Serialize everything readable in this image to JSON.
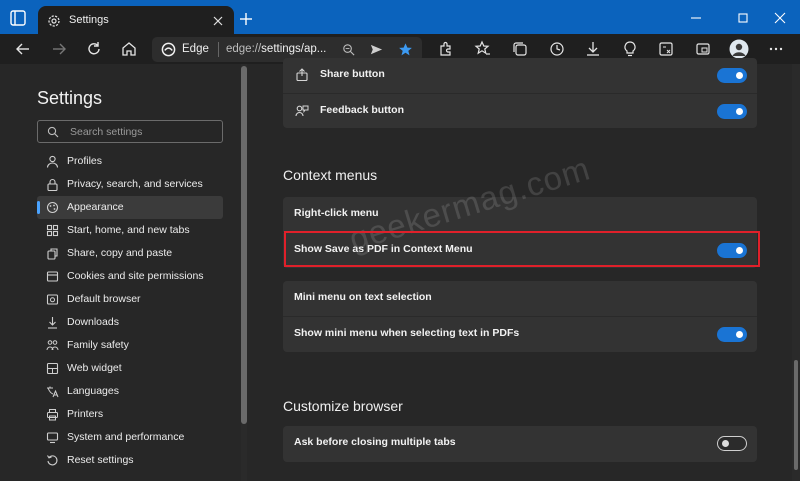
{
  "browser": {
    "tab_title": "Settings",
    "address": {
      "site_label": "Edge",
      "url_scheme": "edge://",
      "url_rest": "settings/ap..."
    }
  },
  "sidebar": {
    "title": "Settings",
    "search_placeholder": "Search settings",
    "items": [
      {
        "label": "Profiles",
        "icon": "profile-icon"
      },
      {
        "label": "Privacy, search, and services",
        "icon": "lock-icon"
      },
      {
        "label": "Appearance",
        "icon": "appearance-icon",
        "active": true
      },
      {
        "label": "Start, home, and new tabs",
        "icon": "home-grid-icon"
      },
      {
        "label": "Share, copy and paste",
        "icon": "share-icon"
      },
      {
        "label": "Cookies and site permissions",
        "icon": "cookie-icon"
      },
      {
        "label": "Default browser",
        "icon": "browser-icon"
      },
      {
        "label": "Downloads",
        "icon": "download-icon"
      },
      {
        "label": "Family safety",
        "icon": "family-icon"
      },
      {
        "label": "Web widget",
        "icon": "widget-icon"
      },
      {
        "label": "Languages",
        "icon": "language-icon"
      },
      {
        "label": "Printers",
        "icon": "printer-icon"
      },
      {
        "label": "System and performance",
        "icon": "system-icon"
      },
      {
        "label": "Reset settings",
        "icon": "reset-icon"
      }
    ]
  },
  "main": {
    "toolbar_buttons_card": {
      "rows": [
        {
          "label": "Share button",
          "icon": "share-icon",
          "toggle": "on"
        },
        {
          "label": "Feedback button",
          "icon": "feedback-icon",
          "toggle": "on"
        }
      ]
    },
    "context_menus": {
      "title": "Context menus",
      "right_click_card": {
        "header": "Right-click menu",
        "rows": [
          {
            "label": "Show Save as PDF in Context Menu",
            "toggle": "on",
            "highlighted": true
          }
        ]
      },
      "mini_menu_card": {
        "header": "Mini menu on text selection",
        "rows": [
          {
            "label": "Show mini menu when selecting text in PDFs",
            "toggle": "on"
          }
        ]
      }
    },
    "customize_browser": {
      "title": "Customize browser",
      "rows": [
        {
          "label": "Ask before closing multiple tabs",
          "toggle": "off"
        }
      ]
    }
  },
  "watermark": "geekermag.com",
  "colors": {
    "titlebar": "#0b63bd",
    "page_bg": "#272727",
    "card_bg": "#333333",
    "toggle_on": "#1a74d4",
    "highlight_border": "#e0202a"
  }
}
